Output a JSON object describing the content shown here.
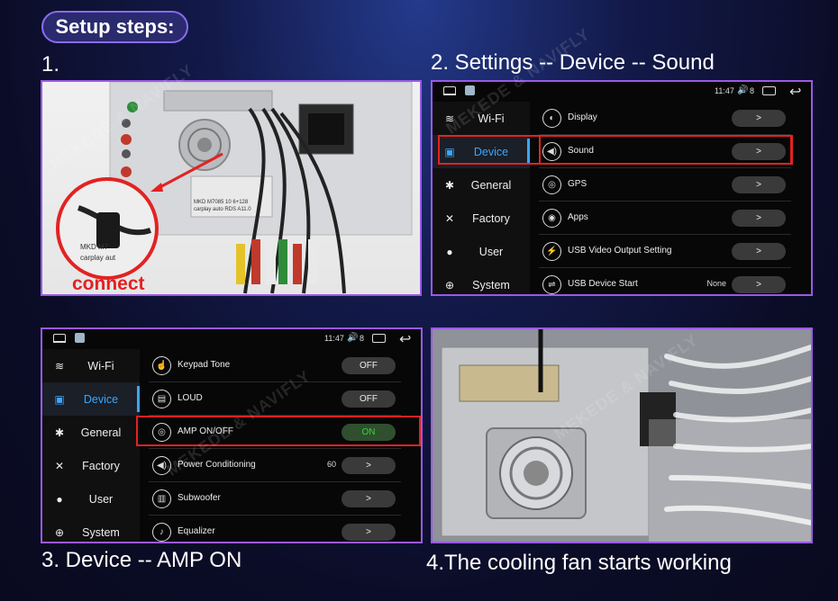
{
  "header": {
    "title": "Setup steps:"
  },
  "steps": {
    "s1": "1.",
    "s2": "2. Settings -- Device -- Sound",
    "s3": "3. Device -- AMP ON",
    "s4": "4.The cooling fan starts working"
  },
  "photo1": {
    "callout": "connect",
    "label_lines": [
      "MKD M7085 10 6+128",
      "carplay auto RDS A11.0",
      "MKD M7",
      "carplay aut"
    ]
  },
  "screen_common": {
    "time": "11:47",
    "volume_icon": "speaker-icon",
    "volume_level": "8",
    "sidebar": [
      {
        "label": "Wi-Fi",
        "icon": "wifi-icon"
      },
      {
        "label": "Device",
        "icon": "device-icon",
        "active": true
      },
      {
        "label": "General",
        "icon": "gear-icon"
      },
      {
        "label": "Factory",
        "icon": "tools-icon"
      },
      {
        "label": "User",
        "icon": "user-icon"
      },
      {
        "label": "System",
        "icon": "globe-icon"
      }
    ]
  },
  "screen2": {
    "rows": [
      {
        "label": "Display",
        "icon": "display-icon",
        "control": ">"
      },
      {
        "label": "Sound",
        "icon": "sound-icon",
        "control": ">",
        "highlighted": true
      },
      {
        "label": "GPS",
        "icon": "gps-icon",
        "control": ">"
      },
      {
        "label": "Apps",
        "icon": "apps-icon",
        "control": ">"
      },
      {
        "label": "USB Video Output Setting",
        "icon": "usb-video-icon",
        "control": ">"
      },
      {
        "label": "USB Device Start",
        "icon": "usb-icon",
        "control": ">",
        "value": "None"
      }
    ]
  },
  "screen3": {
    "rows": [
      {
        "label": "Keypad Tone",
        "icon": "keypad-icon",
        "control": "OFF"
      },
      {
        "label": "LOUD",
        "icon": "loud-icon",
        "control": "OFF"
      },
      {
        "label": "AMP ON/OFF",
        "icon": "amp-icon",
        "control": "ON",
        "highlighted": true
      },
      {
        "label": "Power Conditioning",
        "icon": "power-sound-icon",
        "control": ">",
        "value": "60"
      },
      {
        "label": "Subwoofer",
        "icon": "subwoofer-icon",
        "control": ">"
      },
      {
        "label": "Equalizer",
        "icon": "equalizer-icon",
        "control": ">"
      }
    ]
  },
  "watermark": "MEKEDE & NAVIFLY",
  "colors": {
    "accent": "#3ba6ff",
    "highlight": "#e32222",
    "border": "#9b59e6",
    "on": "#3fd13f"
  }
}
